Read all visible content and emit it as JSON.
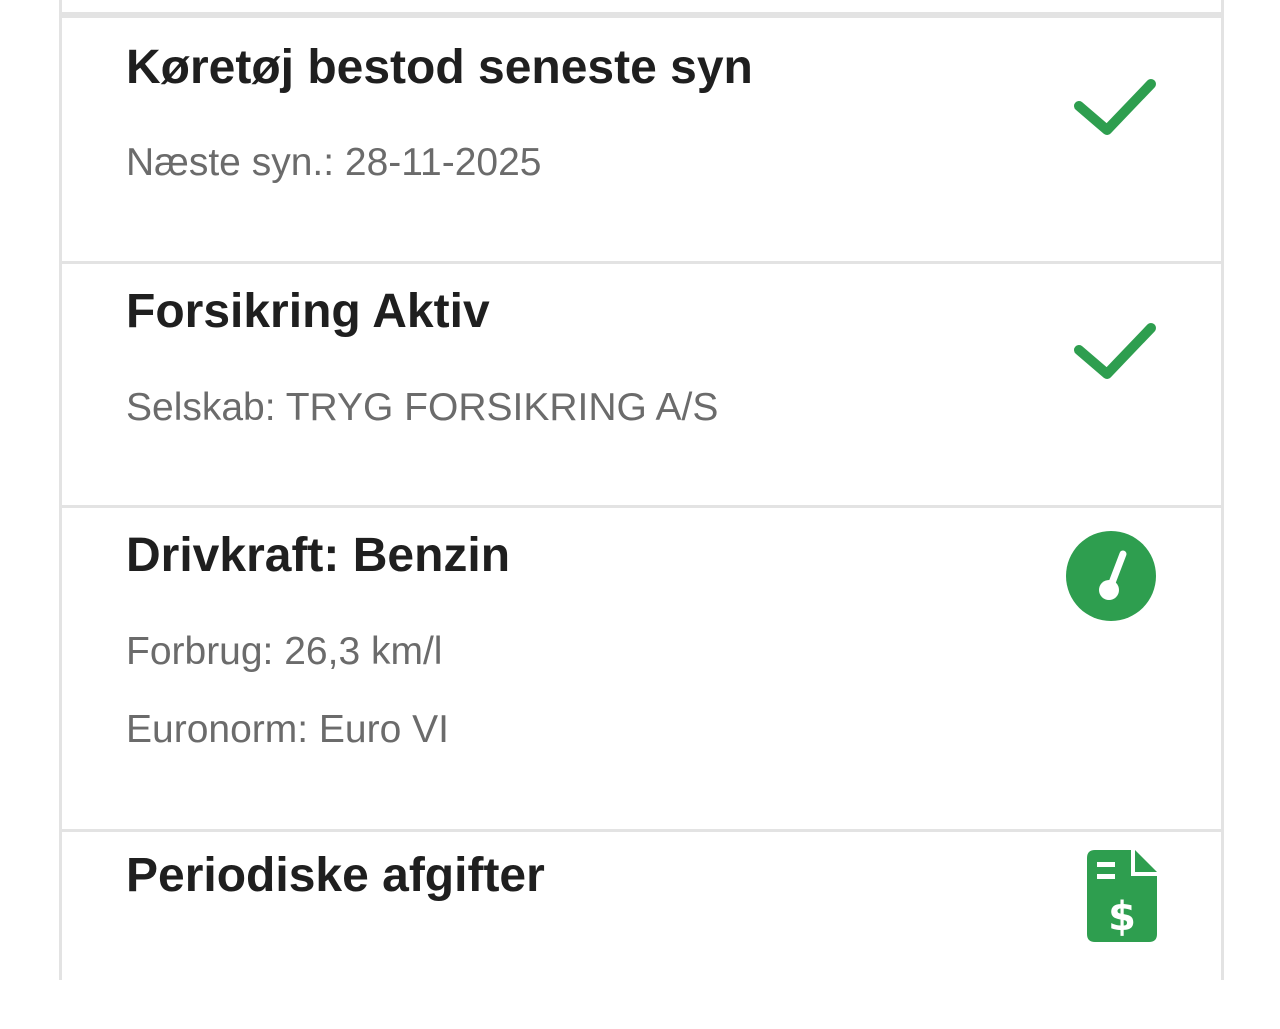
{
  "items": [
    {
      "title": "Køretøj bestod seneste syn",
      "details": [
        "Næste syn.: 28-11-2025"
      ],
      "icon": "check-icon"
    },
    {
      "title": "Forsikring Aktiv",
      "details": [
        "Selskab: TRYG FORSIKRING A/S"
      ],
      "icon": "check-icon"
    },
    {
      "title": "Drivkraft: Benzin",
      "details": [
        "Forbrug: 26,3 km/l",
        "Euronorm: Euro VI"
      ],
      "icon": "speedometer-icon"
    },
    {
      "title": "Periodiske afgifter",
      "details": [],
      "icon": "invoice-dollar-icon"
    }
  ],
  "colors": {
    "accent": "#2e9e4f",
    "title": "#1f1f1f",
    "detail": "#6b6b6b",
    "border": "#e3e3e3"
  }
}
